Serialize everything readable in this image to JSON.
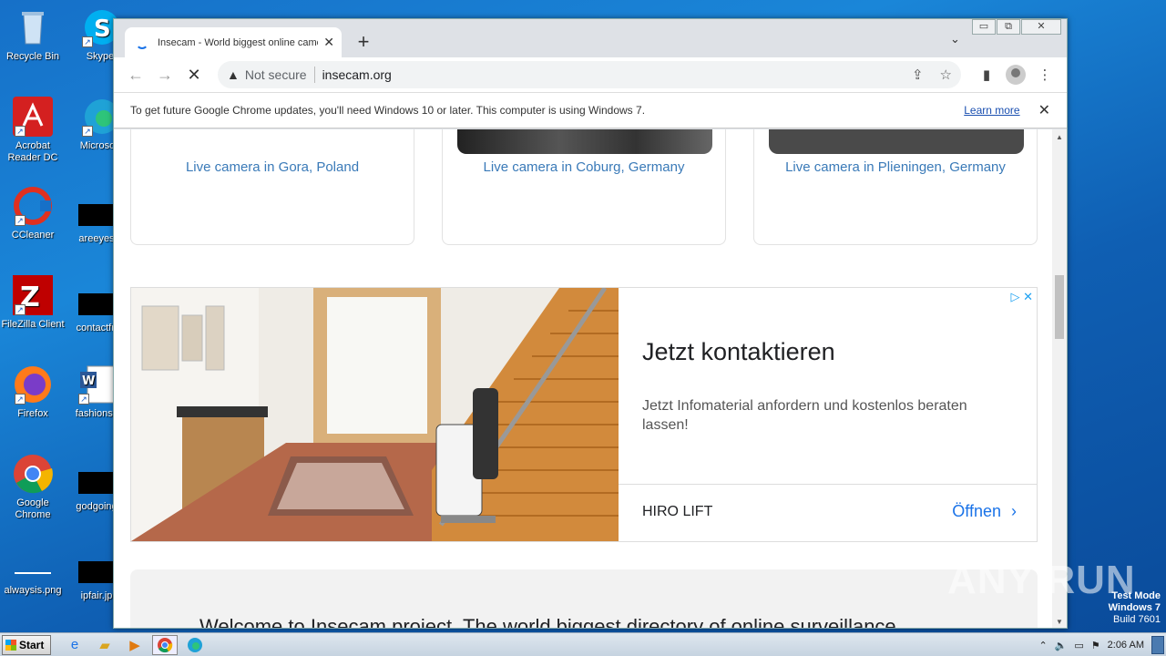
{
  "desktop": {
    "icons_left": [
      {
        "label": "Recycle Bin",
        "icon": "recycle-bin-icon"
      },
      {
        "label": "Acrobat Reader DC",
        "icon": "acrobat-icon"
      },
      {
        "label": "CCleaner",
        "icon": "ccleaner-icon"
      },
      {
        "label": "FileZilla Client",
        "icon": "filezilla-icon"
      },
      {
        "label": "Firefox",
        "icon": "firefox-icon"
      },
      {
        "label": "Google Chrome",
        "icon": "chrome-icon"
      },
      {
        "label": "alwaysis.png",
        "icon": "png-file-icon"
      }
    ],
    "icons_right": [
      {
        "label": "Skype",
        "icon": "skype-icon"
      },
      {
        "label": "Microsoft",
        "icon": "edge-icon"
      },
      {
        "label": "areeyes",
        "icon": "file-icon"
      },
      {
        "label": "contactfri",
        "icon": "file-icon"
      },
      {
        "label": "fashionsy",
        "icon": "word-doc-icon"
      },
      {
        "label": "godgoing",
        "icon": "file-icon"
      },
      {
        "label": "ipfair.jp",
        "icon": "file-icon"
      }
    ]
  },
  "browser": {
    "tab": {
      "title": "Insecam - World biggest online came",
      "close": "✕"
    },
    "new_tab": "+",
    "tab_search": "⌄",
    "window_controls": {
      "minimize": "▭",
      "restore": "⧉",
      "close": "✕"
    },
    "toolbar": {
      "back": "←",
      "forward": "→",
      "stop": "✕",
      "security_label": "Not secure",
      "url": "insecam.org"
    },
    "infobar": {
      "message": "To get future Google Chrome updates, you'll need Windows 10 or later. This computer is using Windows 7.",
      "link": "Learn more",
      "close": "✕"
    },
    "page": {
      "cameras": [
        {
          "caption": "Live camera in Gora, Poland"
        },
        {
          "caption": "Live camera in Coburg, Germany"
        },
        {
          "caption": "Live camera in Plieningen, Germany"
        }
      ],
      "ad": {
        "headline": "Jetzt kontaktieren",
        "description": "Jetzt Infomaterial anfordern und kostenlos beraten lassen!",
        "brand": "HIRO LIFT",
        "cta": "Öffnen",
        "cta_icon": "›",
        "adchoices": "▷ ✕"
      },
      "welcome_text": "Welcome to Insecam project. The world biggest directory of online surveillance"
    }
  },
  "taskbar": {
    "start_label": "Start",
    "clock": "2:06 AM",
    "apps": [
      "ie-icon",
      "explorer-icon",
      "media-player-icon",
      "chrome-icon",
      "edge-icon"
    ]
  },
  "overlay": {
    "watermark": "ANY RUN",
    "test_mode_line1": "Test Mode",
    "test_mode_line2": "Windows 7",
    "test_mode_line3": "Build 7601"
  }
}
